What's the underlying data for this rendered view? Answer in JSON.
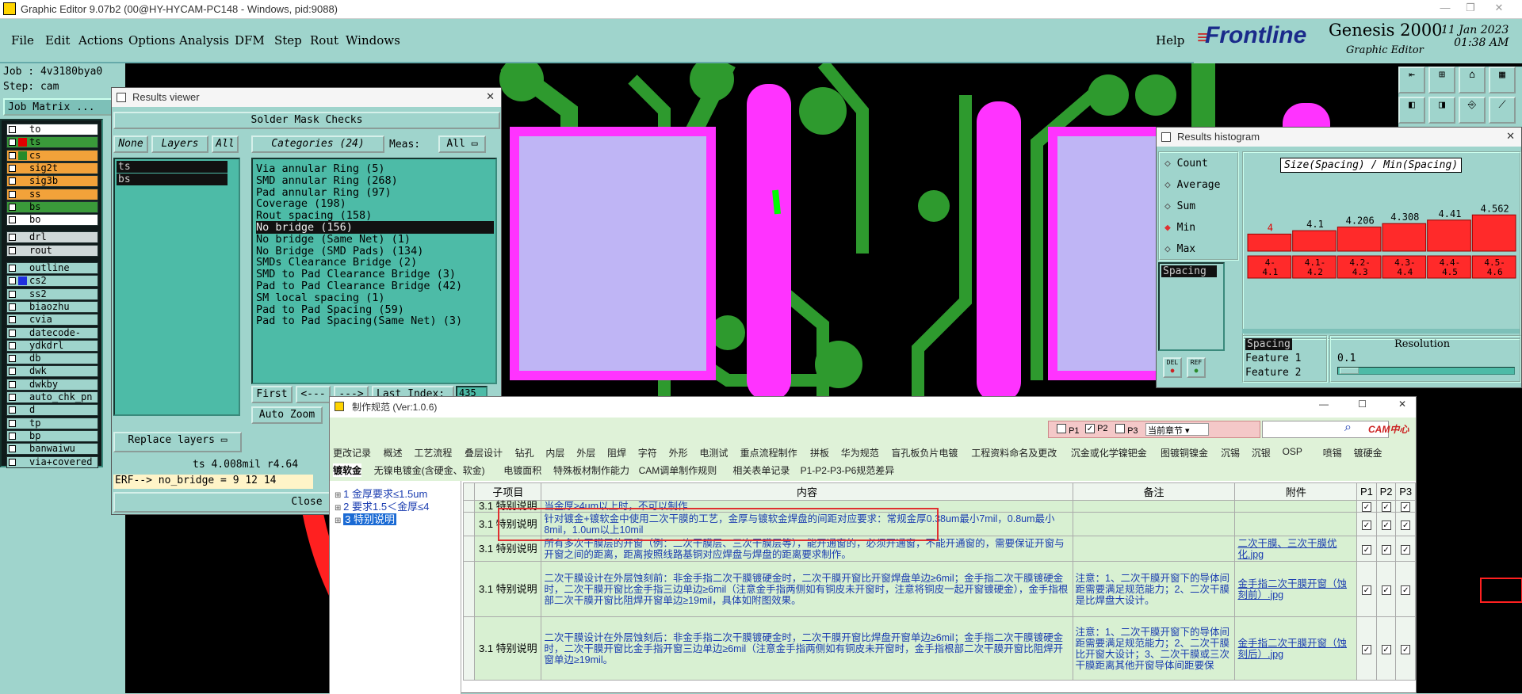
{
  "window": {
    "title": "Graphic Editor 9.07b2 (00@HY-HYCAM-PC148 - Windows, pid:9088)"
  },
  "menu": [
    "File",
    "Edit",
    "Actions",
    "Options",
    "Analysis",
    "DFM",
    "Step",
    "Rout",
    "Windows"
  ],
  "help": "Help",
  "brand": {
    "logo": "Frontline",
    "product": "Genesis 2000",
    "sub": "Graphic Editor",
    "date": "11 Jan 2023",
    "time": "01:38 AM"
  },
  "left": {
    "job": "Job : 4v3180bya0",
    "step": "Step: cam",
    "job_matrix": "Job Matrix ..."
  },
  "layers": [
    {
      "name": "to",
      "bg": "#ffffff",
      "c": "#ffffff"
    },
    {
      "name": "ts",
      "bg": "#3a9a3a",
      "c": "#e00000"
    },
    {
      "name": "cs",
      "bg": "#f2a23a",
      "c": "#2a8a2a"
    },
    {
      "name": "sig2t",
      "bg": "#f2a23a",
      "c": "#f2a23a"
    },
    {
      "name": "sig3b",
      "bg": "#f2a23a",
      "c": "#f2a23a"
    },
    {
      "name": "ss",
      "bg": "#f2a23a",
      "c": "#f2a23a"
    },
    {
      "name": "bs",
      "bg": "#3a9a3a",
      "c": "#3a9a3a"
    },
    {
      "name": "bo",
      "bg": "#ffffff",
      "c": "#ffffff"
    },
    {
      "name": "drl",
      "bg": "#cfd8d8",
      "c": "#cfd8d8"
    },
    {
      "name": "rout",
      "bg": "#cfd8d8",
      "c": "#cfd8d8"
    },
    {
      "name": "outline",
      "bg": "#9fd4cc",
      "c": "#9fd4cc"
    },
    {
      "name": "cs2",
      "bg": "#9fd4cc",
      "c": "#2030e0"
    },
    {
      "name": "ss2",
      "bg": "#9fd4cc",
      "c": "#9fd4cc"
    },
    {
      "name": "biaozhu",
      "bg": "#9fd4cc",
      "c": "#9fd4cc"
    },
    {
      "name": "cvia",
      "bg": "#9fd4cc",
      "c": "#9fd4cc"
    },
    {
      "name": "datecode-pte",
      "bg": "#9fd4cc",
      "c": "#9fd4cc"
    },
    {
      "name": "ydkdrl",
      "bg": "#9fd4cc",
      "c": "#9fd4cc"
    },
    {
      "name": "db",
      "bg": "#9fd4cc",
      "c": "#9fd4cc"
    },
    {
      "name": "dwk",
      "bg": "#9fd4cc",
      "c": "#9fd4cc"
    },
    {
      "name": "dwkby",
      "bg": "#9fd4cc",
      "c": "#9fd4cc"
    },
    {
      "name": "auto_chk_pn",
      "bg": "#9fd4cc",
      "c": "#9fd4cc"
    },
    {
      "name": "d",
      "bg": "#9fd4cc",
      "c": "#9fd4cc"
    },
    {
      "name": "tp",
      "bg": "#9fd4cc",
      "c": "#9fd4cc"
    },
    {
      "name": "bp",
      "bg": "#9fd4cc",
      "c": "#9fd4cc"
    },
    {
      "name": "banwaiwu",
      "bg": "#9fd4cc",
      "c": "#9fd4cc"
    },
    {
      "name": "via+covered",
      "bg": "#9fd4cc",
      "c": "#9fd4cc"
    }
  ],
  "results_viewer": {
    "title": "Results viewer",
    "header": "Solder Mask Checks",
    "none": "None",
    "layers": "Layers",
    "all": "All",
    "categories": "Categories (24)",
    "meas": "Meas:",
    "meas_val": "All",
    "layer_list": [
      "ts",
      "bs"
    ],
    "cat_list": [
      "Via annular Ring (5)",
      "SMD annular Ring (268)",
      "Pad annular Ring (97)",
      "Coverage (198)",
      "Rout spacing (158)",
      "No bridge (156)",
      "No bridge (Same Net) (1)",
      "No Bridge (SMD Pads) (134)",
      "SMDs Clearance Bridge (2)",
      "SMD to Pad Clearance Bridge (3)",
      "Pad to Pad Clearance Bridge (42)",
      "SM local spacing (1)",
      "Pad to Pad Spacing (59)",
      "Pad to Pad Spacing(Same Net) (3)"
    ],
    "selected_index": 5,
    "first": "First",
    "prev": "<---",
    "next": "--->",
    "last": "Last",
    "index": "Index:",
    "index_val": "435",
    "autozoom": "Auto Zoom",
    "replace": "Replace layers",
    "status": "ts 4.008mil  r4.64",
    "erf": "ERF--> no_bridge = 9 12 14",
    "close": "Close"
  },
  "histogram": {
    "title": "Results histogram",
    "options": [
      "Count",
      "Average",
      "Sum",
      "Min",
      "Max"
    ],
    "selected": "Min",
    "spacing": "Spacing",
    "heading": "Size(Spacing) / Min(Spacing)",
    "del": "DEL",
    "ref": "REF",
    "resolution": "Resolution",
    "res_val": "0.1",
    "fields": [
      "Spacing",
      "Feature 1",
      "Feature 2"
    ]
  },
  "chart_data": {
    "type": "bar",
    "title": "Size(Spacing) / Min(Spacing)",
    "categories": [
      "4-\n4.1",
      "4.1-\n4.2",
      "4.2-\n4.3",
      "4.3-\n4.4",
      "4.4-\n4.5",
      "4.5-\n4.6"
    ],
    "values": [
      4,
      4.1,
      4.206,
      4.308,
      4.41,
      4.562
    ],
    "labels": [
      "4",
      "4.1",
      "4.206",
      "4.308",
      "4.41",
      "4.562"
    ]
  },
  "spec": {
    "title": "制作规范 (Ver:1.0.6)",
    "checks": [
      "P1",
      "P2",
      "P3"
    ],
    "section": "当前章节",
    "cam_logo": "CAM中心",
    "tabs1": [
      "更改记录",
      "概述",
      "工艺流程",
      "叠层设计",
      "钻孔",
      "内层",
      "外层",
      "阻焊",
      "字符",
      "外形",
      "电测试",
      "重点流程制作",
      "拼板",
      "华为规范",
      "盲孔板负片电镀",
      "工程资料命名及更改",
      "沉金或化学镍钯金",
      "图镀铜镍金",
      "沉锡",
      "沉银",
      "OSP",
      "喷锡",
      "镀硬金"
    ],
    "tabs2": [
      "镀软金",
      "无镍电镀金(含硬金、软金)",
      "电镀面积",
      "特殊板材制作能力",
      "CAM调单制作规则",
      "相关表单记录",
      "P1-P2-P3-P6规范差异"
    ],
    "tree": [
      "1 金厚要求≤1.5um",
      "2 要求1.5＜金厚≤4",
      "3 特别说明"
    ],
    "headers": [
      "子项目",
      "内容",
      "备注",
      "附件",
      "P1",
      "P2",
      "P3"
    ],
    "rows": [
      {
        "num": "3.1",
        "sub": "特别说明",
        "content": "当金厚≥4um以上时，不可以制作",
        "note": "",
        "att": ""
      },
      {
        "num": "3.1",
        "sub": "特别说明",
        "content": "针对镀金+镀软金中使用二次干膜的工艺，金厚与镀软金焊盘的间距对应要求：常规金厚0.38um最小7mil，0.8um最小8mil，1.0um以上10mil",
        "note": "",
        "att": ""
      },
      {
        "num": "3.1",
        "sub": "特别说明",
        "content": "所有多次干膜层的开窗（例：二次干膜层、三次干膜层等），能开通窗的，必须开通窗，不能开通窗的，需要保证开窗与开窗之间的距离，距离按照线路基铜对应焊盘与焊盘的距离要求制作。",
        "note": "",
        "att": "二次干膜、三次干膜优化.jpg"
      },
      {
        "num": "3.1",
        "sub": "特别说明",
        "content": "二次干膜设计在外层蚀刻前：非金手指二次干膜镀硬金时，二次干膜开窗比开窗焊盘单边≥6mil；金手指二次干膜镀硬金时，二次干膜开窗比金手指三边单边≥6mil（注意金手指两侧如有铜皮未开窗时，注意将铜皮一起开窗镀硬金），金手指根部二次干膜开窗比阻焊开窗单边≥19mil，具体如附图效果。",
        "note": "注意：1、二次干膜开窗下的导体间距需要满足规范能力；2、二次干膜是比焊盘大设计。",
        "att": "金手指二次干膜开窗（蚀刻前）.jpg"
      },
      {
        "num": "3.1",
        "sub": "特别说明",
        "content": "二次干膜设计在外层蚀刻后：非金手指二次干膜镀硬金时，二次干膜开窗比焊盘开窗单边≥6mil；金手指二次干膜镀硬金时，二次干膜开窗比金手指开窗三边单边≥6mil（注意金手指两侧如有铜皮未开窗时，金手指根部二次干膜开窗比阻焊开窗单边≥19mil。",
        "note": "注意：1、二次干膜开窗下的导体间距需要满足规范能力；2、二次干膜比开窗大设计；3、二次干膜或三次干膜距离其他开窗导体间距要保",
        "att": "金手指二次干膜开窗（蚀刻后）.jpg"
      }
    ]
  }
}
